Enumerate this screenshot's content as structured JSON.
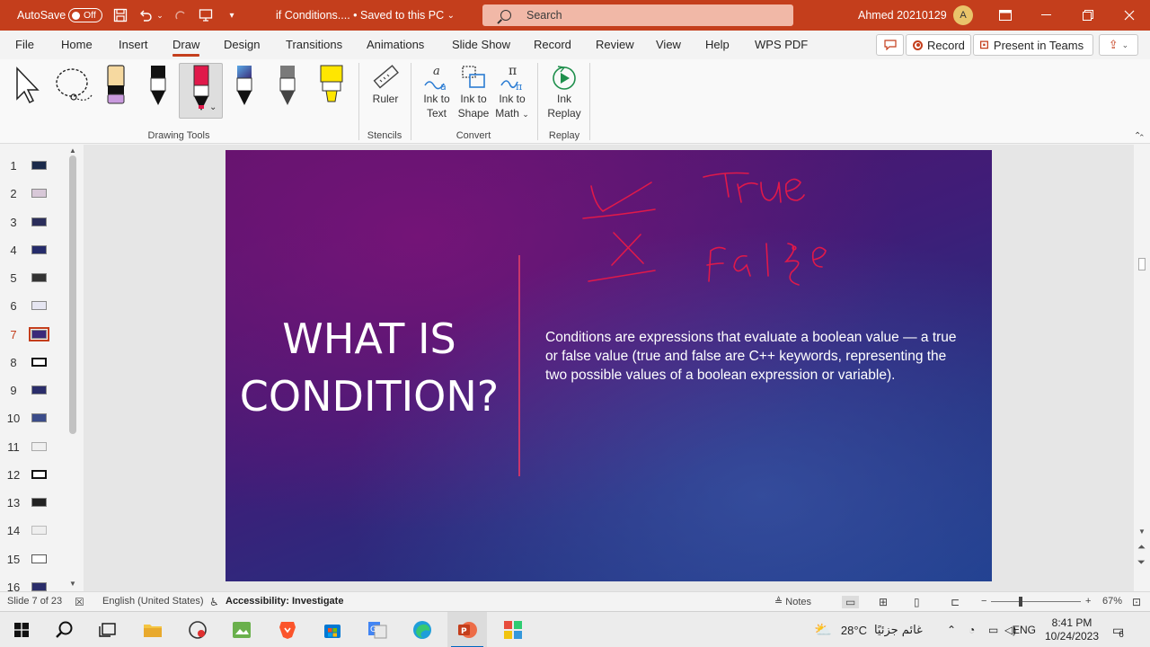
{
  "titlebar": {
    "autosave_label": "AutoSave",
    "autosave_state": "Off",
    "document_title": "if Conditions....  •  Saved to this PC",
    "search_placeholder": "Search",
    "user_name": "Ahmed 20210129",
    "user_initial": "A",
    "accent_color": "#c43e1c"
  },
  "ribbon_tabs": {
    "tabs": [
      "File",
      "Home",
      "Insert",
      "Draw",
      "Design",
      "Transitions",
      "Animations",
      "Slide Show",
      "Record",
      "Review",
      "View",
      "Help",
      "WPS PDF"
    ],
    "active": "Draw",
    "record_label": "Record",
    "present_label": "Present in Teams"
  },
  "ribbon": {
    "groups": {
      "drawing_tools": "Drawing Tools",
      "stencils": "Stencils",
      "convert": "Convert",
      "replay": "Replay"
    },
    "ruler": "Ruler",
    "ink_to_text_1": "Ink to",
    "ink_to_text_2": "Text",
    "ink_to_shape_1": "Ink to",
    "ink_to_shape_2": "Shape",
    "ink_to_math_1": "Ink to",
    "ink_to_math_2": "Math",
    "ink_replay_1": "Ink",
    "ink_replay_2": "Replay"
  },
  "thumbnails": {
    "numbers": [
      "1",
      "2",
      "3",
      "4",
      "5",
      "6",
      "7",
      "8",
      "9",
      "10",
      "11",
      "12",
      "13",
      "14",
      "15",
      "16"
    ],
    "active_index": 7
  },
  "slide": {
    "title_line1": "WHAT IS",
    "title_line2": "CONDITION?",
    "body": "Conditions are expressions that evaluate a boolean value — a true or false value (true and false are C++ keywords, representing the two possible values of a boolean expression or variable).",
    "ink_word_1": "True",
    "ink_word_2": "False",
    "ink_color": "#e0194a"
  },
  "statusbar": {
    "slide_info": "Slide 7 of 23",
    "language": "English (United States)",
    "accessibility": "Accessibility: Investigate",
    "notes": "Notes",
    "zoom": "67%"
  },
  "taskbar": {
    "temperature": "28°C",
    "weather_text": "غائم جزئيًا",
    "lang": "ENG",
    "time": "8:41 PM",
    "date": "10/24/2023",
    "notification_count": "6"
  }
}
